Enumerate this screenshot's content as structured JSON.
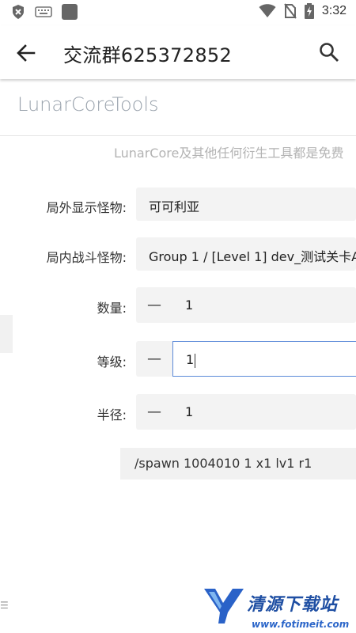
{
  "status_bar": {
    "time": "3:32"
  },
  "app_bar": {
    "title": "交流群625372852"
  },
  "page": {
    "brand": "LunarCoreTools",
    "notice": "LunarCore及其他任何衍生工具都是免费"
  },
  "form": {
    "outer_monster": {
      "label": "局外显示怪物:",
      "value": "可可利亚"
    },
    "inner_monster": {
      "label": "局内战斗怪物:",
      "value": "Group 1 / [Level 1] dev_测试关卡A"
    },
    "quantity": {
      "label": "数量:",
      "minus": "—",
      "value": "1"
    },
    "level": {
      "label": "等级:",
      "minus": "—",
      "value": "1"
    },
    "radius": {
      "label": "半径:",
      "minus": "—",
      "value": "1"
    },
    "command": "/spawn 1004010 1 x1 lv1 r1"
  },
  "side_handle": "☰",
  "watermark": {
    "name": "清源下载站",
    "url": "www.fotimeit.com"
  },
  "colors": {
    "accent": "#5b8ad8",
    "brand_text": "#9aa3ad",
    "field_bg": "#f3f3f3"
  }
}
